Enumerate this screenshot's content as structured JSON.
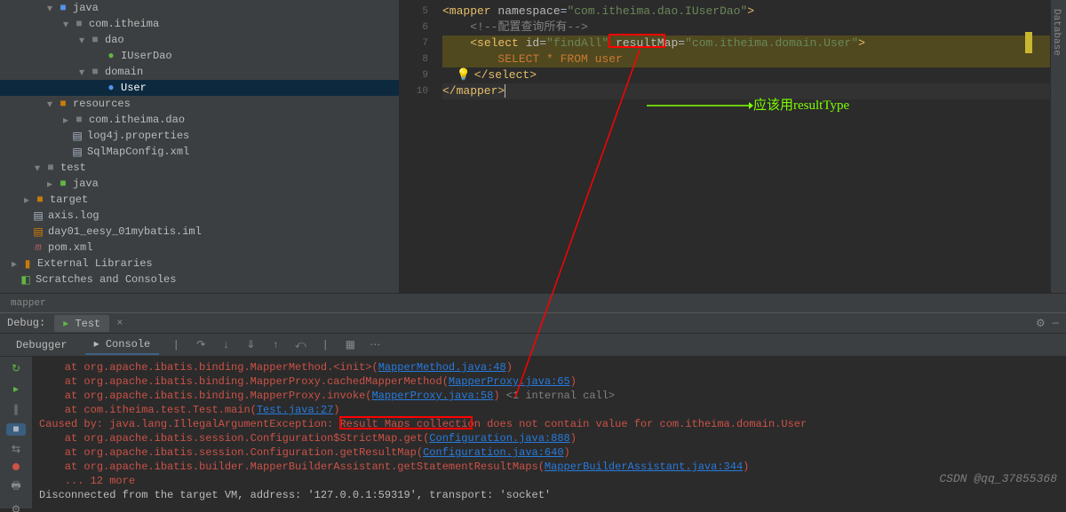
{
  "tree": {
    "java": "java",
    "comItheima": "com.itheima",
    "dao": "dao",
    "iUserDao": "IUserDao",
    "domain": "domain",
    "user": "User",
    "resources": "resources",
    "comItheimaDao": "com.itheima.dao",
    "log4j": "log4j.properties",
    "sqlMapConfig": "SqlMapConfig.xml",
    "test": "test",
    "java2": "java",
    "target": "target",
    "axisLog": "axis.log",
    "day01": "day01_eesy_01mybatis.iml",
    "pom": "pom.xml",
    "extLibs": "External Libraries",
    "scratches": "Scratches and Consoles"
  },
  "gutter": [
    "5",
    "6",
    "7",
    "8",
    "9",
    "10"
  ],
  "code": {
    "l5_mapper": "<mapper",
    "l5_ns": " namespace",
    "l5_eq": "=",
    "l5_val": "\"com.itheima.dao.IUserDao\"",
    "l5_close": ">",
    "l6": "<!--配置查询所有-->",
    "l7_select": "<select",
    "l7_id": " id",
    "l7_idval": "\"findAll\"",
    "l7_rm": " resultMap",
    "l7_rmval": "\"com.itheima.domain.User\"",
    "l7_close": ">",
    "l8": "SELECT * FROM user",
    "l9": "</select>",
    "l10": "</mapper>"
  },
  "annotation": {
    "shouldUse": "应该用resultType"
  },
  "breadcrumb": "mapper",
  "debug": {
    "label": "Debug:",
    "testTab": "Test",
    "debuggerTab": "Debugger",
    "consoleTab": "Console"
  },
  "stack": {
    "l1_at": "    at ",
    "l1_cls": "org.apache.ibatis.binding.MapperMethod.<init>(",
    "l1_link": "MapperMethod.java:48",
    "l1_rp": ")",
    "l2_cls": "org.apache.ibatis.binding.MapperProxy.cachedMapperMethod(",
    "l2_link": "MapperProxy.java:65",
    "l3_cls": "org.apache.ibatis.binding.MapperProxy.invoke(",
    "l3_link": "MapperProxy.java:58",
    "l3_tail": " <1 internal call>",
    "l4_cls": "com.itheima.test.Test.main(",
    "l4_link": "Test.java:27",
    "l5_a": "Caused by: java.lang.IllegalArgumentException: ",
    "l5_b": "Result Maps collection",
    "l5_c": " does not contain value for com.itheima.domain.User",
    "l6_cls": "org.apache.ibatis.session.Configuration$StrictMap.get(",
    "l6_link": "Configuration.java:888",
    "l7_cls": "org.apache.ibatis.session.Configuration.getResultMap(",
    "l7_link": "Configuration.java:640",
    "l8_cls": "org.apache.ibatis.builder.MapperBuilderAssistant.getStatementResultMaps(",
    "l8_link": "MapperBuilderAssistant.java:344",
    "l9": "    ... 12 more",
    "l10": "Disconnected from the target VM, address: '127.0.0.1:59319', transport: 'socket'"
  },
  "rightBar": "Database",
  "watermark": "CSDN @qq_37855368"
}
